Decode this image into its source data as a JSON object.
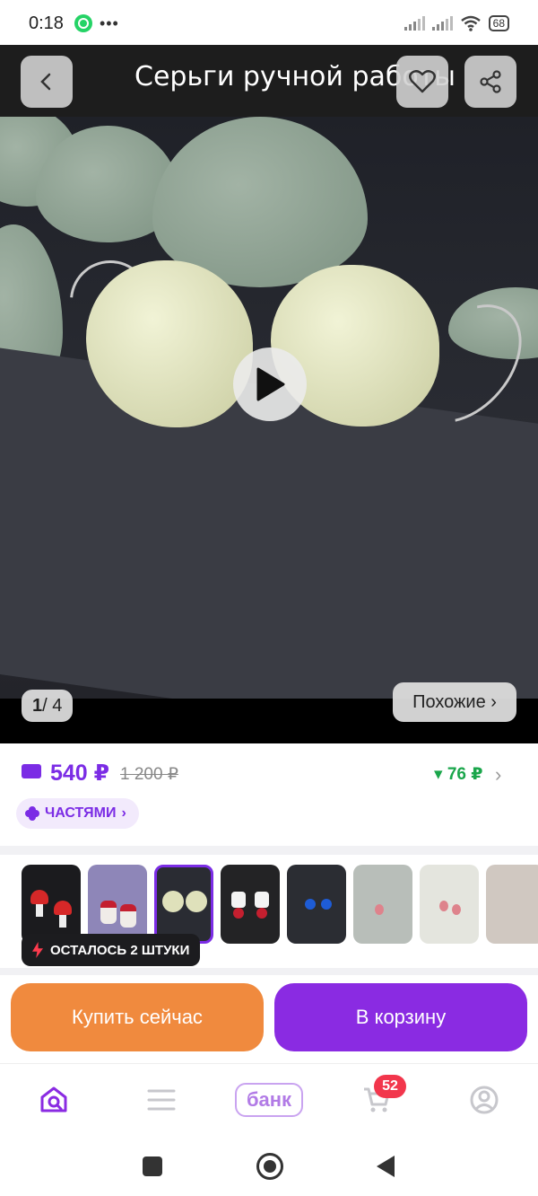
{
  "status_bar": {
    "time": "0:18",
    "battery": "68",
    "icons": [
      "whatsapp-icon",
      "more-dots-icon",
      "signal-icon",
      "signal-icon",
      "wifi-icon",
      "battery-icon"
    ]
  },
  "header": {
    "title": "Серьги ручной работы",
    "back_icon": "chevron-left-icon",
    "favorite_icon": "heart-icon",
    "share_icon": "share-icon"
  },
  "gallery": {
    "current": "1",
    "total": "4",
    "separator": "/",
    "similar_label": "Похожие ›",
    "play_icon": "play-icon"
  },
  "price": {
    "current": "540 ₽",
    "old": "1 200 ₽",
    "cashback": "▾ 76 ₽",
    "installments_label": "ЧАСТЯМИ",
    "wallet_icon": "wallet-icon"
  },
  "variants": {
    "stock_label": "ОСТАЛОСЬ 2 ШТУКИ",
    "items": [
      {
        "name": "mushroom-earrings"
      },
      {
        "name": "tooth-earrings"
      },
      {
        "name": "dumpling-earrings"
      },
      {
        "name": "flower-earrings"
      },
      {
        "name": "blue-earrings"
      },
      {
        "name": "grey-earrings"
      },
      {
        "name": "strawberry-earrings"
      },
      {
        "name": "other-earrings"
      }
    ]
  },
  "actions": {
    "buy_now": "Купить сейчас",
    "to_cart": "В корзину"
  },
  "bottom_nav": {
    "bank_label": "банк",
    "cart_count": "52",
    "items": [
      "home-search-icon",
      "catalog-icon",
      "bank",
      "cart-icon",
      "profile-icon"
    ]
  },
  "colors": {
    "accent": "#7b2ce5",
    "buy_now": "#f08a3e",
    "to_cart": "#8a2be2",
    "cashback": "#1aa64b",
    "badge": "#f2364c"
  }
}
